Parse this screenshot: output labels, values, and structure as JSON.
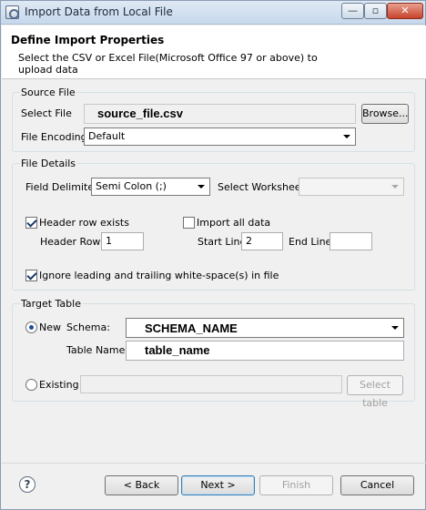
{
  "window": {
    "title": "Import Data from Local File",
    "minimize_glyph": "—",
    "maximize_glyph": "▫",
    "close_glyph": "✕"
  },
  "header": {
    "title": "Define Import Properties",
    "description": "Select the CSV or Excel File(Microsoft Office 97 or above) to upload data"
  },
  "source_file": {
    "group_label": "Source File",
    "select_file_label": "Select File",
    "select_file_value": "source_file.csv",
    "browse_label": "Browse...",
    "encoding_label": "File Encoding",
    "encoding_value": "Default"
  },
  "file_details": {
    "group_label": "File Details",
    "field_delimiter_label": "Field Delimiter",
    "field_delimiter_value": "Semi Colon (;)",
    "select_worksheet_label": "Select Worksheet:",
    "select_worksheet_value": "",
    "header_row_exists_label": "Header row exists",
    "header_row_exists_checked": true,
    "import_all_data_label": "Import all data",
    "import_all_data_checked": false,
    "header_row_label": "Header Row :",
    "header_row_value": "1",
    "start_line_label": "Start Line",
    "start_line_value": "2",
    "end_line_label": "End Line",
    "end_line_value": "",
    "ignore_whitespace_label": "Ignore leading and trailing white-space(s) in file",
    "ignore_whitespace_checked": true
  },
  "target_table": {
    "group_label": "Target Table",
    "new_label": "New",
    "new_selected": true,
    "schema_label": "Schema:",
    "schema_value": "SCHEMA_NAME",
    "table_name_label": "Table Name:",
    "table_name_value": "table_name",
    "existing_label": "Existing",
    "existing_selected": false,
    "existing_value": "",
    "select_table_label": "Select table"
  },
  "footer": {
    "help_glyph": "?",
    "back_label": "< Back",
    "next_label": "Next >",
    "finish_label": "Finish",
    "cancel_label": "Cancel"
  },
  "colors": {
    "window_bg": "#f0f0f0",
    "header_bg": "#ffffff",
    "default_button_border": "#3c7fb1",
    "checkmark": "#1b3a6b"
  }
}
